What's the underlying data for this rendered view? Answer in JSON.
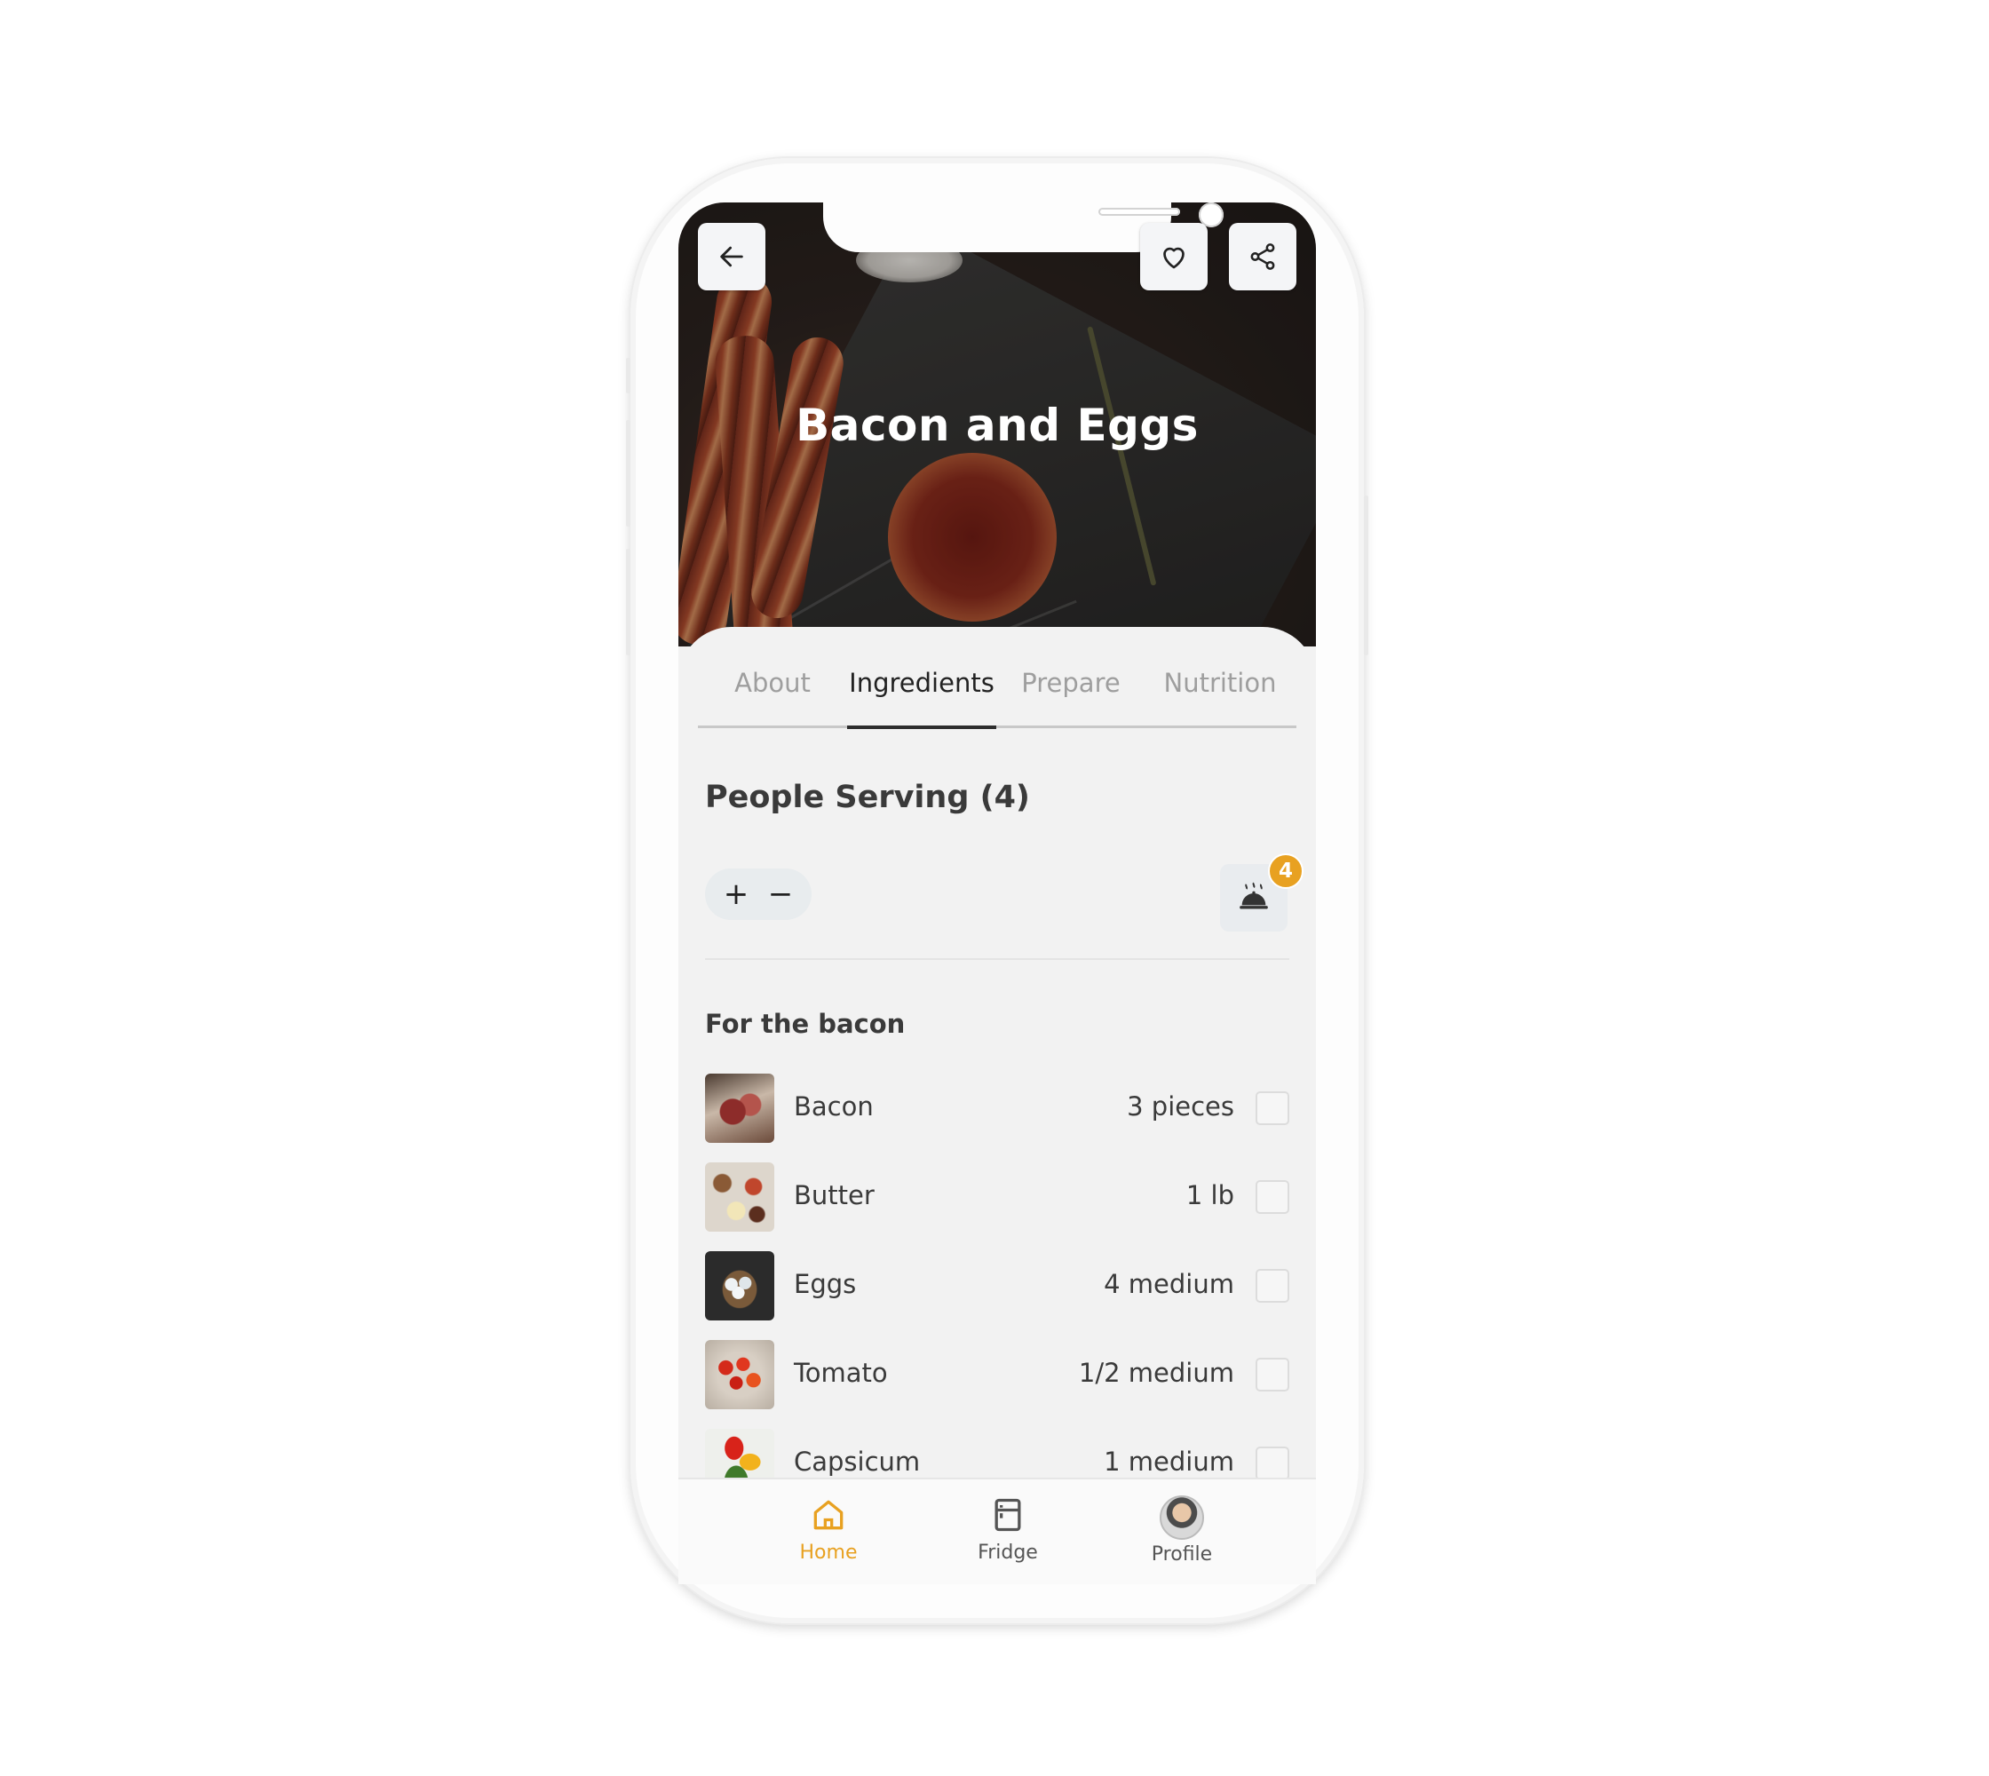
{
  "recipe": {
    "title": "Bacon and Eggs"
  },
  "header_buttons": {
    "back": "arrow-left-icon",
    "favorite": "heart-icon",
    "share": "share-icon"
  },
  "tabs": [
    {
      "label": "About",
      "active": false
    },
    {
      "label": "Ingredients",
      "active": true
    },
    {
      "label": "Prepare",
      "active": false
    },
    {
      "label": "Nutrition",
      "active": false
    }
  ],
  "serving": {
    "title": "People Serving (4)",
    "plus": "+",
    "minus": "−",
    "badge_count": "4",
    "icon": "serving-dish-icon"
  },
  "section": {
    "title": "For the bacon"
  },
  "ingredients": [
    {
      "name": "Bacon",
      "qty": "3 pieces",
      "checked": false
    },
    {
      "name": "Butter",
      "qty": "1 lb",
      "checked": false
    },
    {
      "name": "Eggs",
      "qty": "4 medium",
      "checked": false
    },
    {
      "name": "Tomato",
      "qty": "1/2 medium",
      "checked": false
    },
    {
      "name": "Capsicum",
      "qty": "1 medium",
      "checked": false
    }
  ],
  "bottom_nav": [
    {
      "label": "Home",
      "icon": "home-icon",
      "active": true
    },
    {
      "label": "Fridge",
      "icon": "fridge-icon",
      "active": false
    },
    {
      "label": "Profile",
      "icon": "avatar",
      "active": false
    }
  ],
  "colors": {
    "accent": "#e8a121",
    "text": "#3a3a3a",
    "muted_tab": "#9e9e9e",
    "background": "#f2f2f2"
  }
}
